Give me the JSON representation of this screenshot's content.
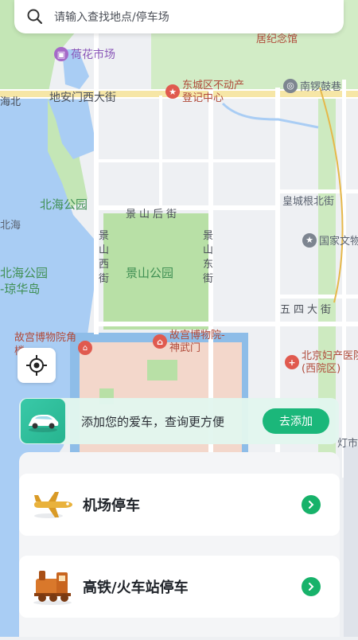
{
  "search": {
    "placeholder": "请输入查找地点/停车场"
  },
  "map": {
    "labels": {
      "jinianguan": "居纪念馆",
      "hehua_market": "荷花市场",
      "dianmen_street": "地安门西大街",
      "haibei": "海北",
      "dongcheng_registry": "东城区不动产登记中心",
      "nanluoguxiang": "南锣鼓巷",
      "beihai_park": "北海公园",
      "beihai": "北海",
      "jingshan_hou": "景山后街",
      "jingshan_xi": "景山西街",
      "jingshan_dong": "景山东街",
      "jingshan_park": "景山公园",
      "huangcheng": "皇城根北街",
      "guojia": "国家文物",
      "beihai_park2": "北海公园",
      "qionghuadao": "-琼华岛",
      "wusi": "五四大街",
      "gugong_jiaolou": "故宫博物院角楼",
      "gugong_shenwu": "故宫博物院-神武门",
      "fuchan": "北京妇产医院(西院区)",
      "deng": "灯市"
    }
  },
  "promo": {
    "text": "添加您的爱车，查询更方便",
    "button": "去添加"
  },
  "cards": [
    {
      "title": "机场停车",
      "icon": "airplane-icon"
    },
    {
      "title": "高铁/火车站停车",
      "icon": "train-icon"
    }
  ],
  "colors": {
    "accent": "#1bb77a",
    "water": "#a9cdf4",
    "park": "#b8e0a6",
    "palace": "#f3d7cb"
  }
}
